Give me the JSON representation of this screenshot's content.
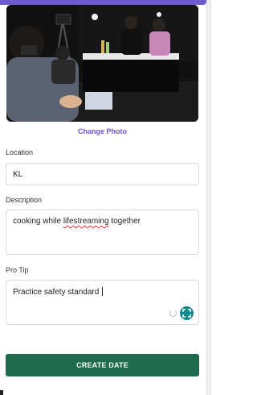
{
  "photo": {
    "alt": "Photo of people cooking during a livestream"
  },
  "change_photo_label": "Change Photo",
  "location": {
    "label": "Location",
    "value": "KL"
  },
  "description": {
    "label": "Description",
    "before": "cooking while ",
    "misspelled": "lifestreaming",
    "after": " together"
  },
  "pro_tip": {
    "label": "Pro Tip",
    "value": "Practice safety standard "
  },
  "create_button_label": "CREATE DATE",
  "colors": {
    "accent": "#6d5bd0",
    "button": "#1d6a4c",
    "expand_icon": "#0f8a89",
    "link": "#6a5acd"
  },
  "icons": [
    "refresh-icon",
    "expand-icon"
  ]
}
